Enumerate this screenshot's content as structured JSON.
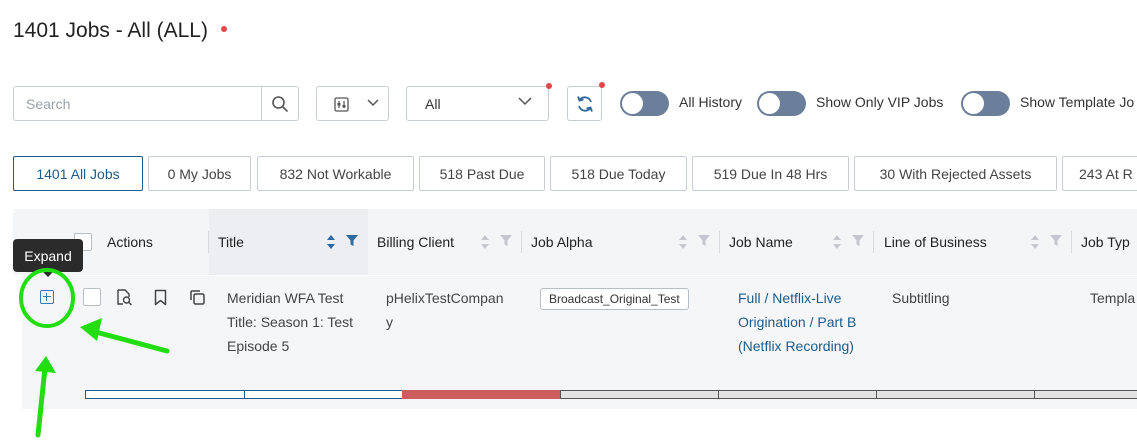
{
  "page": {
    "title": "1401 Jobs - All (ALL)"
  },
  "toolbar": {
    "search_placeholder": "Search",
    "status_select_value": "All",
    "toggles": [
      {
        "label": "All History",
        "on": false
      },
      {
        "label": "Show Only VIP Jobs",
        "on": false
      },
      {
        "label": "Show Template Jo",
        "on": false
      }
    ]
  },
  "tabs": [
    {
      "label": "1401 All Jobs",
      "active": true
    },
    {
      "label": "0 My Jobs",
      "active": false
    },
    {
      "label": "832 Not Workable",
      "active": false
    },
    {
      "label": "518 Past Due",
      "active": false
    },
    {
      "label": "518 Due Today",
      "active": false
    },
    {
      "label": "519 Due In 48 Hrs",
      "active": false
    },
    {
      "label": "30 With Rejected Assets",
      "active": false
    },
    {
      "label": "243 At R",
      "active": false
    }
  ],
  "table": {
    "columns": [
      "Actions",
      "Title",
      "Billing Client",
      "Job Alpha",
      "Job Name",
      "Line of Business",
      "Job Typ"
    ],
    "rows": [
      {
        "title_lines": [
          "Meridian WFA Test",
          "Title: Season 1: Test",
          "Episode 5"
        ],
        "billing_client_lines": [
          "pHelixTestCompan",
          "y"
        ],
        "job_alpha": "Broadcast_Original_Test",
        "job_name_lines": [
          "Full / Netflix-Live",
          "Origination / Part B",
          "(Netflix Recording)"
        ],
        "line_of_business": "Subtitling",
        "job_type": "Templa"
      }
    ]
  },
  "tooltip": {
    "text": "Expand"
  },
  "colors": {
    "accent": "#1c5c8c",
    "toggle_off": "#6b7f9b",
    "notification_dot": "#e04848",
    "progress_red": "#cd5c5c",
    "annotation_green": "#22dd11"
  },
  "icons": [
    "search-icon",
    "filter-sliders-icon",
    "chevron-down-icon",
    "refresh-icon",
    "sort-icon",
    "filter-funnel-icon",
    "expand-icon",
    "preview-icon",
    "bookmark-icon",
    "copy-icon"
  ]
}
